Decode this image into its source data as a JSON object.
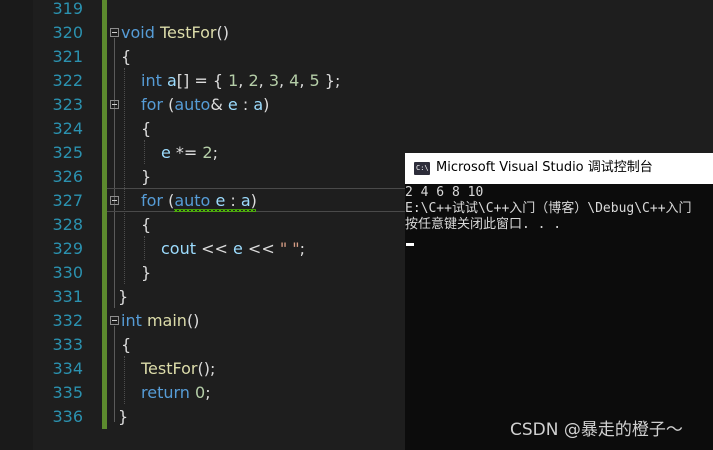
{
  "editor": {
    "line_numbers": [
      "319",
      "320",
      "321",
      "322",
      "323",
      "324",
      "325",
      "326",
      "327",
      "328",
      "329",
      "330",
      "331",
      "332",
      "333",
      "334",
      "335",
      "336"
    ],
    "code": {
      "l320": {
        "kw": "void",
        "fn": "TestFor",
        "rest": "()"
      },
      "l321": {
        "text": "{"
      },
      "l322": {
        "kw": "int",
        "var": "a",
        "p1": "[] = { ",
        "n1": "1",
        "c1": ", ",
        "n2": "2",
        "c2": ", ",
        "n3": "3",
        "c3": ", ",
        "n4": "4",
        "c4": ", ",
        "n5": "5",
        "p2": " };"
      },
      "l323": {
        "kw": "for",
        "p1": " (",
        "kw2": "auto",
        "p2": "& ",
        "var": "e",
        "p3": " : ",
        "var2": "a",
        "p4": ")"
      },
      "l324": {
        "text": "{"
      },
      "l325": {
        "var": "e",
        "p1": " *= ",
        "num": "2",
        "p2": ";"
      },
      "l326": {
        "text": "}"
      },
      "l327": {
        "kw": "for",
        "p1": " (",
        "kw2": "auto",
        "p2": " ",
        "var": "e",
        "p3": " : ",
        "var2": "a",
        "p4": ")"
      },
      "l328": {
        "text": "{"
      },
      "l329": {
        "var": "cout",
        "p1": " << ",
        "var2": "e",
        "p2": " << ",
        "str": "\" \"",
        "p3": ";"
      },
      "l330": {
        "text": "}"
      },
      "l331": {
        "text": "}"
      },
      "l332": {
        "kw": "int",
        "fn": "main",
        "rest": "()"
      },
      "l333": {
        "text": "{"
      },
      "l334": {
        "fn": "TestFor",
        "rest": "();"
      },
      "l335": {
        "kw": "return",
        "p1": " ",
        "num": "0",
        "p2": ";"
      },
      "l336": {
        "text": "}"
      }
    }
  },
  "console": {
    "title": "Microsoft Visual Studio 调试控制台",
    "icon": "console-app-icon",
    "icon_label": "C:\\",
    "lines": [
      "2 4 6 8 10",
      "E:\\C++试试\\C++入门（博客）\\Debug\\C++入门",
      "按任意键关闭此窗口. . ."
    ]
  },
  "watermark": "CSDN @暴走的橙子～",
  "colors": {
    "background": "#1e1e1e",
    "line_number": "#2b91af",
    "keyword": "#569cd6",
    "function": "#dcdcaa",
    "variable": "#9cdcfe",
    "number": "#b5cea8",
    "string": "#d69d85",
    "change_bar": "#5c8a2e",
    "console_bg": "#0c0c0c"
  }
}
